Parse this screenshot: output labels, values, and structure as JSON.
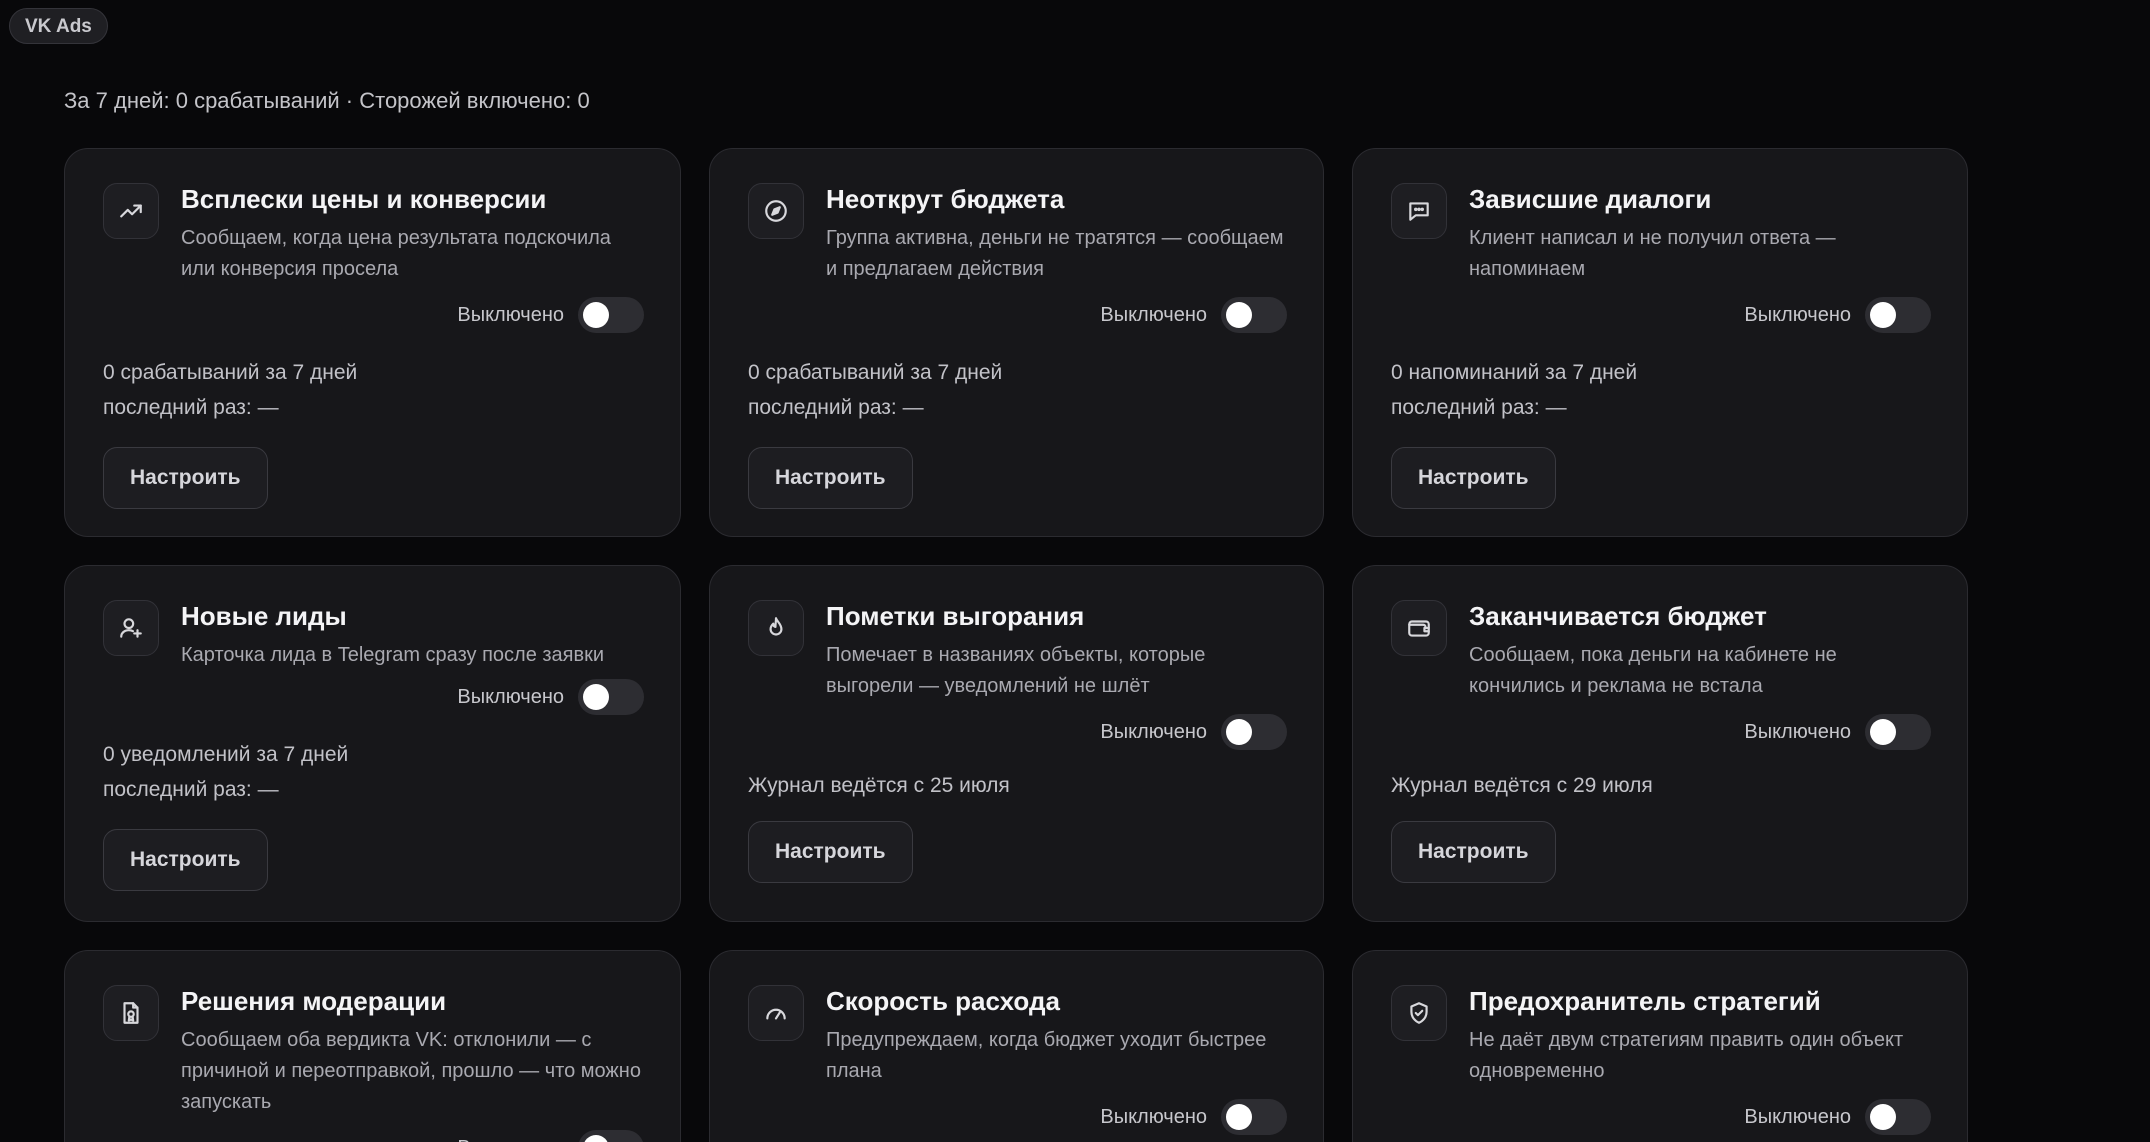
{
  "app": {
    "chip_label": "VK Ads"
  },
  "summary": "За 7 дней: 0 срабатываний · Сторожей включено: 0",
  "toggle_label": "Выключено",
  "configure_label": "Настроить",
  "cards": [
    {
      "icon": "trending-up-icon",
      "title": "Всплески цены и конверсии",
      "desc": "Сообщаем, когда цена результата подскочила или конверсия просела",
      "stat1": "0 срабатываний за 7 дней",
      "stat2": "последний раз: —"
    },
    {
      "icon": "compass-icon",
      "title": "Неоткрут бюджета",
      "desc": "Группа активна, деньги не тратятся — сообщаем и предлагаем действия",
      "stat1": "0 срабатываний за 7 дней",
      "stat2": "последний раз: —"
    },
    {
      "icon": "message-icon",
      "title": "Зависшие диалоги",
      "desc": "Клиент написал и не получил ответа — напоминаем",
      "stat1": "0 напоминаний за 7 дней",
      "stat2": "последний раз: —"
    },
    {
      "icon": "user-plus-icon",
      "title": "Новые лиды",
      "desc": "Карточка лида в Telegram сразу после заявки",
      "stat1": "0 уведомлений за 7 дней",
      "stat2": "последний раз: —"
    },
    {
      "icon": "flame-icon",
      "title": "Пометки выгорания",
      "desc": "Помечает в названиях объекты, которые выгорели — уведомлений не шлёт",
      "stat1": "Журнал ведётся с 25 июля"
    },
    {
      "icon": "wallet-icon",
      "title": "Заканчивается бюджет",
      "desc": "Сообщаем, пока деньги на кабинете не кончились и реклама не встала",
      "stat1": "Журнал ведётся с 29 июля"
    },
    {
      "icon": "file-badge-icon",
      "title": "Решения модерации",
      "desc": "Сообщаем оба вердикта VK: отклонили — с причиной и переотправкой, прошло — что можно запускать"
    },
    {
      "icon": "gauge-icon",
      "title": "Скорость расхода",
      "desc": "Предупреждаем, когда бюджет уходит быстрее плана"
    },
    {
      "icon": "shield-check-icon",
      "title": "Предохранитель стратегий",
      "desc": "Не даёт двум стратегиям править один объект одновременно"
    }
  ]
}
